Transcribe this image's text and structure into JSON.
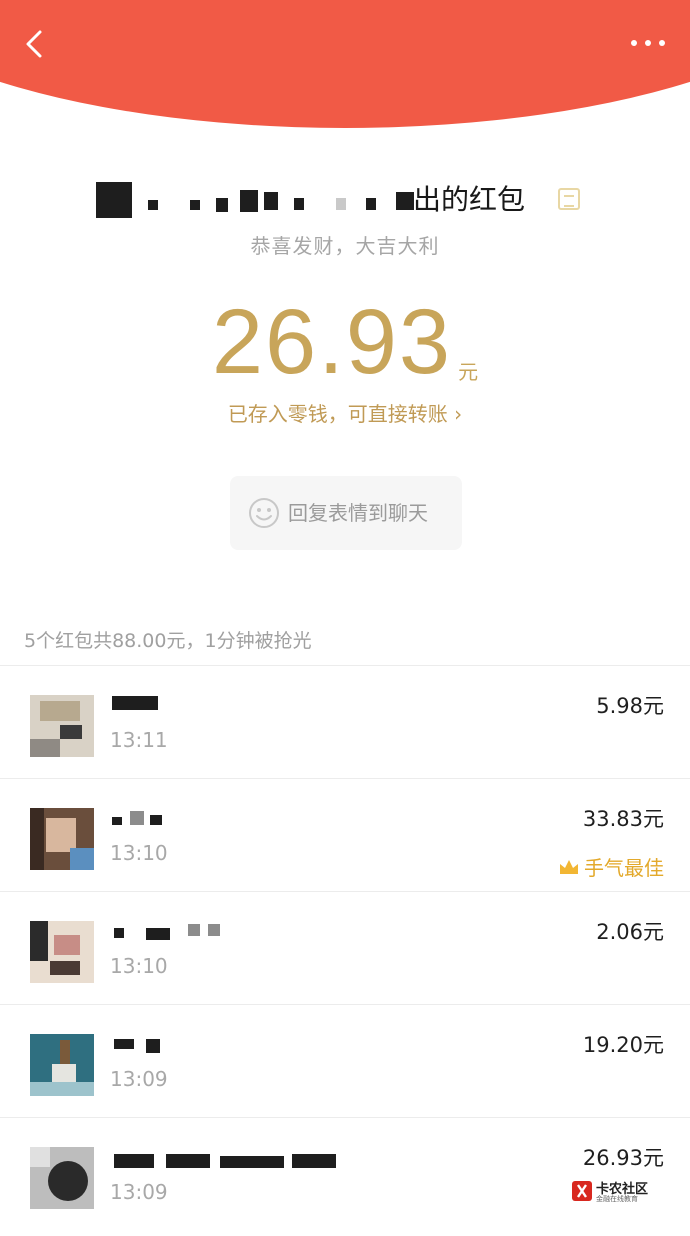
{
  "colors": {
    "header": "#f15a46",
    "gold": "#c8a55a",
    "best_luck": "#e3a92b"
  },
  "header": {
    "back_icon": "chevron-left-icon",
    "more_icon": "more-dots-icon"
  },
  "envelope": {
    "sender_suffix": "出的红包",
    "wishing": "恭喜发财，大吉大利",
    "amount": "26.93",
    "unit": "元",
    "saved_note": "已存入零钱，可直接转账 ›",
    "reply_label": "回复表情到聊天"
  },
  "summary": "5个红包共88.00元，1分钟被抢光",
  "records": [
    {
      "time": "13:11",
      "amount": "5.98元",
      "best": ""
    },
    {
      "time": "13:10",
      "amount": "33.83元",
      "best": "手气最佳"
    },
    {
      "time": "13:10",
      "amount": "2.06元",
      "best": ""
    },
    {
      "time": "13:09",
      "amount": "19.20元",
      "best": ""
    },
    {
      "time": "13:09",
      "amount": "26.93元",
      "best": ""
    }
  ],
  "watermark": {
    "title": "卡农社区",
    "subtitle": "金融在线教育"
  }
}
